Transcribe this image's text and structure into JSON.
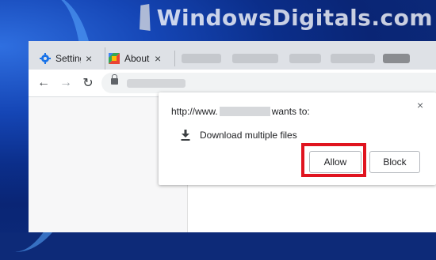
{
  "watermark": {
    "text": "WindowsDigitals.com"
  },
  "tabs": [
    {
      "label": "Settings",
      "icon": "gear-icon"
    },
    {
      "label": "About",
      "icon": "colorful-square-icon"
    }
  ],
  "tab_close_glyph": "×",
  "toolbar": {
    "back": "←",
    "forward": "→",
    "reload": "↻"
  },
  "popup": {
    "origin_prefix": "http://www.",
    "origin_suffix": "wants to:",
    "permission": "Download multiple files",
    "close": "×",
    "allow_label": "Allow",
    "block_label": "Block"
  },
  "colors": {
    "highlight": "#e0141f",
    "accent": "#1a73e8"
  }
}
